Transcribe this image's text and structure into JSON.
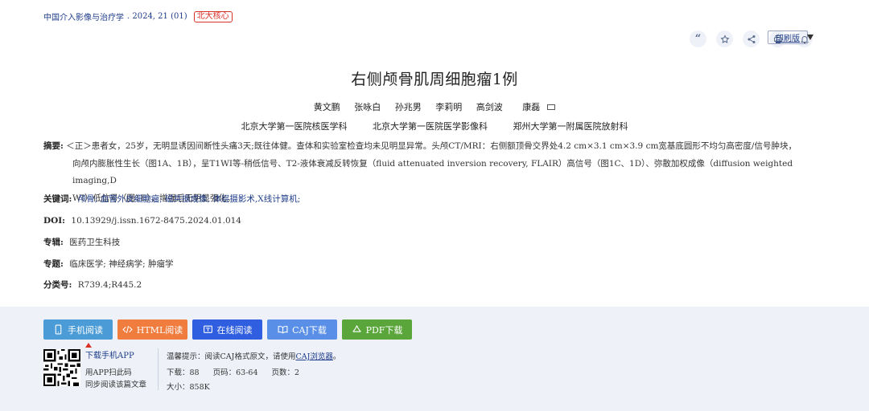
{
  "header": {
    "journal": "中国介入影像与治疗学",
    "issue": ". 2024, 21 (01)",
    "badge": "北大核心"
  },
  "toolbar": {
    "icons": [
      "quote-icon",
      "star-icon",
      "share-icon",
      "print-icon",
      "bell-icon"
    ],
    "quote_glyph": "“",
    "print_version": "印刷版"
  },
  "article": {
    "title": "右侧颅骨肌周细胞瘤1例",
    "authors": [
      "黄文鹏",
      "张咏白",
      "孙兆男",
      "李莉明",
      "高剑波",
      "康磊"
    ],
    "affiliations": [
      "北京大学第一医院核医学科",
      "北京大学第一医院医学影像科",
      "郑州大学第一附属医院放射科"
    ]
  },
  "fields": {
    "abstract_label": "摘要:",
    "abstract_line1": "＜正＞患者女，25岁，无明显诱因间断性头痛3天;既往体健。查体和实验室检查均未见明显异常。头颅CT/MRI：右侧额顶骨交界处4.2 cm×3.1 cm×3.9 cm宽基底圆形不均匀高密度/信号肿块，",
    "abstract_line2": "向颅内膨胀性生长（图1A、1B），呈T1WI等-稍低信号、T2-液体衰减反转恢复（fluid attenuated inversion recovery, FLAIR）高信号（图1C、1D）、弥散加权成像（diffusion weighted imaging,D",
    "abstract_line3": "WI）低信号（图1E），增强后无明显强化。",
    "keywords_label": "关键词:",
    "keywords": [
      "颅骨;",
      "血管外皮细胞瘤;",
      "磁共振成像;",
      "体层摄影术,X线计算机;"
    ],
    "doi_label": "DOI:",
    "doi": "10.13929/j.issn.1672-8475.2024.01.014",
    "series_label": "专辑:",
    "series": "医药卫生科技",
    "topic_label": "专题:",
    "topic": "临床医学; 神经病学; 肿瘤学",
    "class_label": "分类号:",
    "class": "R739.4;R445.2"
  },
  "actions": {
    "mobile": "手机阅读",
    "html": "HTML阅读",
    "online": "在线阅读",
    "caj": "CAJ下载",
    "pdf": "PDF下载",
    "colors": {
      "mobile": "#4a9bd6",
      "html": "#f07c3e",
      "online": "#2f5fe0",
      "caj": "#5a8fe8",
      "pdf": "#5aa63a"
    }
  },
  "app": {
    "link": "下载手机APP",
    "line1": "用APP扫此码",
    "line2": "同步阅读该篇文章"
  },
  "info": {
    "tip_prefix": "温馨提示：阅读CAJ格式原文，请使用",
    "tip_link": "CAJ浏览器",
    "tip_suffix": "。",
    "downloads": "下载：88",
    "pages": "页码：63-64",
    "page_count": "页数：2",
    "size": "大小：858K"
  }
}
